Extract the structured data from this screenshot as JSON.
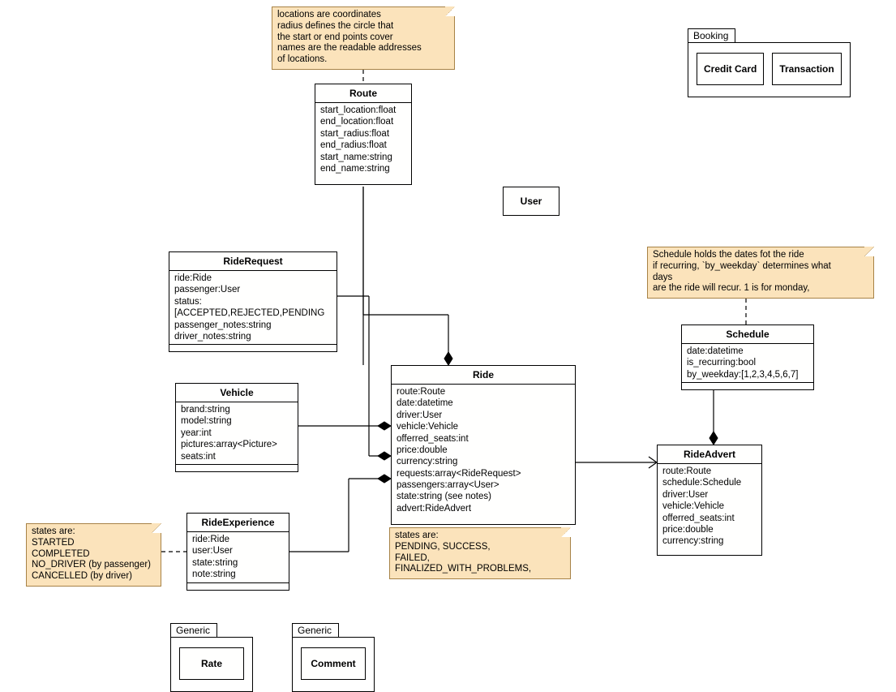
{
  "notes": {
    "route_note": "locations are coordinates\nradius defines the circle that\nthe start or end points cover\nnames are the readable addresses\nof locations.",
    "schedule_note": "Schedule holds the dates fot the ride\nif recurring, `by_weekday` determines what\ndays\nare the ride will recur. 1 is for monday,",
    "rideexp_note": "states are:\nSTARTED\nCOMPLETED\nNO_DRIVER (by passenger)\nCANCELLED (by driver)",
    "ride_note": "states are:\nPENDING, SUCCESS,\nFAILED,\nFINALIZED_WITH_PROBLEMS,"
  },
  "classes": {
    "route": {
      "name": "Route",
      "attrs": [
        "start_location:float",
        "end_location:float",
        "start_radius:float",
        "end_radius:float",
        "start_name:string",
        "end_name:string"
      ]
    },
    "user": {
      "name": "User"
    },
    "riderequest": {
      "name": "RideRequest",
      "attrs": [
        "ride:Ride",
        "passenger:User",
        "status:[ACCEPTED,REJECTED,PENDING",
        "passenger_notes:string",
        "driver_notes:string"
      ]
    },
    "vehicle": {
      "name": "Vehicle",
      "attrs": [
        "brand:string",
        "model:string",
        "year:int",
        "pictures:array<Picture>",
        "seats:int"
      ]
    },
    "rideexp": {
      "name": "RideExperience",
      "attrs": [
        "ride:Ride",
        "user:User",
        "state:string",
        "note:string"
      ]
    },
    "ride": {
      "name": "Ride",
      "attrs": [
        "route:Route",
        "date:datetime",
        "driver:User",
        "vehicle:Vehicle",
        "offerred_seats:int",
        "price:double",
        "currency:string",
        "requests:array<RideRequest>",
        "passengers:array<User>",
        "state:string (see notes)",
        "advert:RideAdvert"
      ]
    },
    "schedule": {
      "name": "Schedule",
      "attrs": [
        "date:datetime",
        "is_recurring:bool",
        "by_weekday:[1,2,3,4,5,6,7]"
      ]
    },
    "rideadvert": {
      "name": "RideAdvert",
      "attrs": [
        "route:Route",
        "schedule:Schedule",
        "driver:User",
        "vehicle:Vehicle",
        "offerred_seats:int",
        "price:double",
        "currency:string"
      ]
    }
  },
  "packages": {
    "booking": {
      "name": "Booking",
      "items": [
        "Credit Card",
        "Transaction"
      ]
    },
    "generic1": {
      "name": "Generic",
      "items": [
        "Rate"
      ]
    },
    "generic2": {
      "name": "Generic",
      "items": [
        "Comment"
      ]
    }
  }
}
